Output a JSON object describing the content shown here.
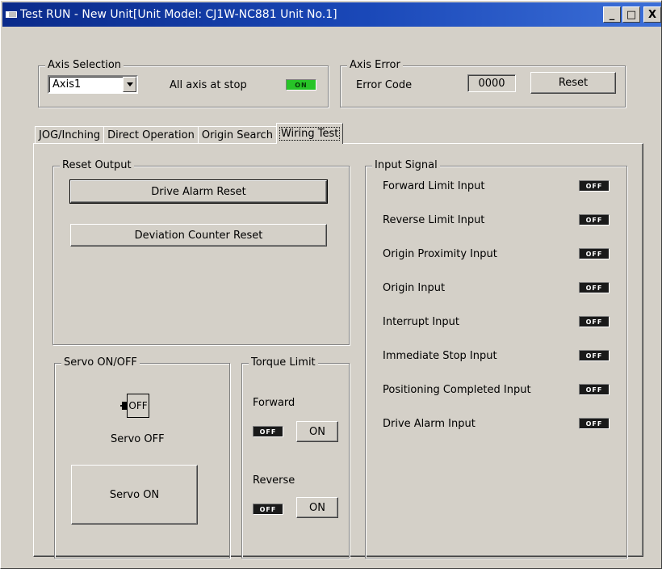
{
  "window": {
    "title": "Test RUN - New Unit[Unit Model: CJ1W-NC881 Unit No.1]",
    "minimize_glyph": "_",
    "maximize_glyph": "□",
    "close_glyph": "X"
  },
  "axis_selection": {
    "legend": "Axis Selection",
    "selected": "Axis1",
    "stop_label": "All axis at stop",
    "stop_lamp": "ON"
  },
  "axis_error": {
    "legend": "Axis Error",
    "code_label": "Error Code",
    "code_value": "0000",
    "reset_label": "Reset"
  },
  "tabs": [
    {
      "label": "JOG/Inching",
      "active": false
    },
    {
      "label": "Direct Operation",
      "active": false
    },
    {
      "label": "Origin Search",
      "active": false
    },
    {
      "label": "Wiring Test",
      "active": true
    }
  ],
  "reset_output": {
    "legend": "Reset Output",
    "drive_alarm_reset": "Drive Alarm Reset",
    "deviation_counter_reset": "Deviation Counter Reset"
  },
  "servo": {
    "legend": "Servo ON/OFF",
    "icon_text": "OFF",
    "status": "Servo OFF",
    "button": "Servo ON"
  },
  "torque_limit": {
    "legend": "Torque Limit",
    "forward_label": "Forward",
    "forward_lamp": "OFF",
    "forward_button": "ON",
    "reverse_label": "Reverse",
    "reverse_lamp": "OFF",
    "reverse_button": "ON"
  },
  "input_signal": {
    "legend": "Input Signal",
    "items": [
      {
        "label": "Forward Limit Input",
        "state": "OFF"
      },
      {
        "label": "Reverse Limit Input",
        "state": "OFF"
      },
      {
        "label": "Origin Proximity Input",
        "state": "OFF"
      },
      {
        "label": "Origin Input",
        "state": "OFF"
      },
      {
        "label": "Interrupt Input",
        "state": "OFF"
      },
      {
        "label": "Immediate Stop Input",
        "state": "OFF"
      },
      {
        "label": "Positioning Completed Input",
        "state": "OFF"
      },
      {
        "label": "Drive Alarm Input",
        "state": "OFF"
      }
    ]
  },
  "colors": {
    "lamp_on": "#27c427",
    "lamp_off": "#1a1a1a",
    "title_bar": "#0a2a8a",
    "face": "#d4d0c8"
  }
}
